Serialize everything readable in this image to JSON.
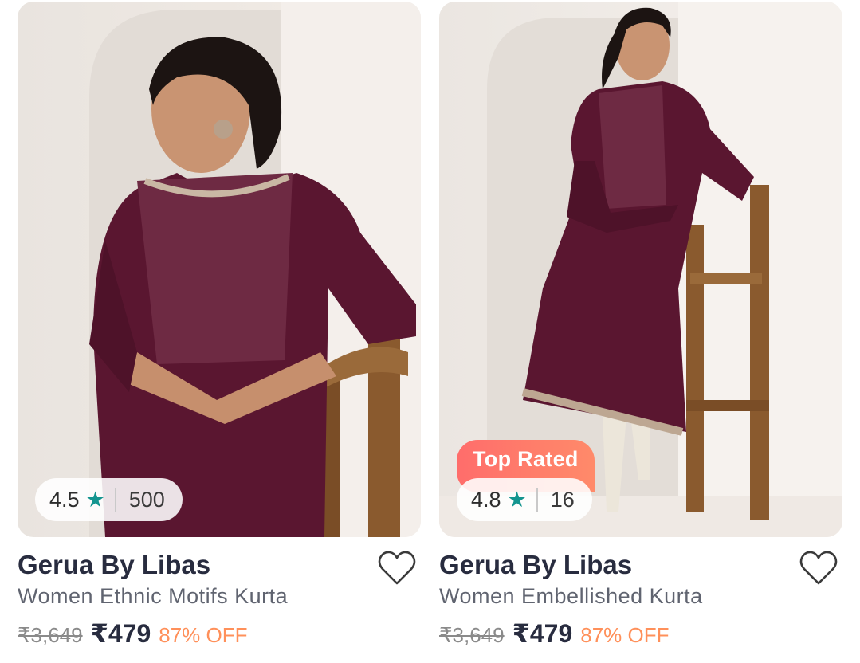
{
  "products": [
    {
      "brand": "Gerua By Libas",
      "title": "Women Ethnic Motifs Kurta",
      "rating": "4.5",
      "rating_count": "500",
      "mrp": "₹3,649",
      "price": "₹479",
      "discount": "87% OFF",
      "badge": null
    },
    {
      "brand": "Gerua By Libas",
      "title": "Women Embellished Kurta",
      "rating": "4.8",
      "rating_count": "16",
      "mrp": "₹3,649",
      "price": "₹479",
      "discount": "87% OFF",
      "badge": "Top Rated"
    }
  ],
  "icons": {
    "star": "star-icon",
    "wishlist": "heart-outline-icon"
  },
  "colors": {
    "rating_star": "#14958f",
    "discount": "#ff905a",
    "badge": "#ff6d6b",
    "kurta": "#5a1630"
  }
}
